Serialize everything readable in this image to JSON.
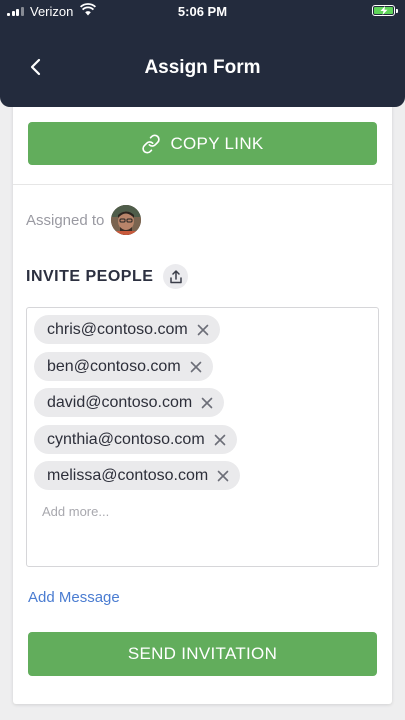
{
  "status_bar": {
    "carrier": "Verizon",
    "time": "5:06 PM"
  },
  "header": {
    "title": "Assign Form",
    "back_icon": "chevron-left-icon"
  },
  "copy_link": {
    "label": "COPY LINK",
    "icon": "link-icon"
  },
  "assigned": {
    "label": "Assigned to"
  },
  "invite": {
    "label": "INVITE PEOPLE",
    "icon": "share-upload-icon",
    "emails": [
      "chris@contoso.com",
      "ben@contoso.com",
      "david@contoso.com",
      "cynthia@contoso.com",
      "melissa@contoso.com"
    ],
    "placeholder": "Add more...",
    "remove_icon": "close-icon"
  },
  "add_message": {
    "label": "Add Message"
  },
  "send": {
    "label": "SEND INVITATION"
  },
  "colors": {
    "header_bg": "#232b3d",
    "button_green": "#62ad5c",
    "link_blue": "#4a7cd1",
    "chip_bg": "#eaeaec"
  }
}
